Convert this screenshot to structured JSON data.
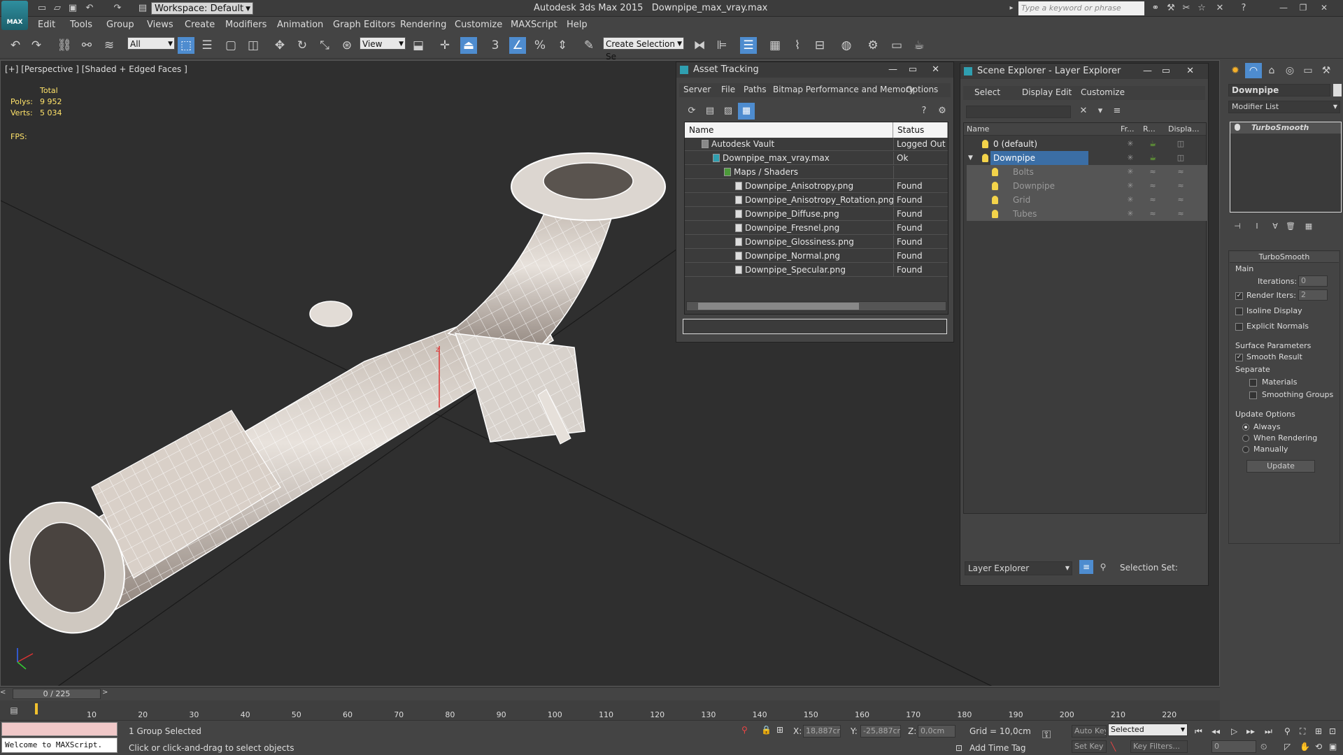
{
  "titlebar": {
    "workspace_label": "Workspace: Default",
    "app_title": "Autodesk 3ds Max 2015",
    "file_name": "Downpipe_max_vray.max",
    "search_placeholder": "Type a keyword or phrase",
    "logo_text": "MAX"
  },
  "menu": [
    "Edit",
    "Tools",
    "Group",
    "Views",
    "Create",
    "Modifiers",
    "Animation",
    "Graph Editors",
    "Rendering",
    "Customize",
    "MAXScript",
    "Help"
  ],
  "toolbar": {
    "selection_filter": "All",
    "ref_coord": "View",
    "named_selection_placeholder": "Create Selection Se",
    "snap_3": "3"
  },
  "viewport": {
    "label": "[+] [Perspective ] [Shaded + Edged Faces ]",
    "total_label": "Total",
    "polys_label": "Polys:",
    "polys_value": "9 952",
    "verts_label": "Verts:",
    "verts_value": "5 034",
    "fps_label": "FPS:",
    "gizmo_axis": "z"
  },
  "asset_tracking": {
    "title": "Asset Tracking",
    "menu": [
      "Server",
      "File",
      "Paths",
      "Bitmap Performance and Memory",
      "Options"
    ],
    "columns": [
      "Name",
      "Status"
    ],
    "rows": [
      {
        "name": "Autodesk Vault",
        "status": "Logged Out ..."
      },
      {
        "name": "Downpipe_max_vray.max",
        "status": "Ok"
      },
      {
        "name": "Maps / Shaders",
        "status": ""
      },
      {
        "name": "Downpipe_Anisotropy.png",
        "status": "Found"
      },
      {
        "name": "Downpipe_Anisotropy_Rotation.png",
        "status": "Found"
      },
      {
        "name": "Downpipe_Diffuse.png",
        "status": "Found"
      },
      {
        "name": "Downpipe_Fresnel.png",
        "status": "Found"
      },
      {
        "name": "Downpipe_Glossiness.png",
        "status": "Found"
      },
      {
        "name": "Downpipe_Normal.png",
        "status": "Found"
      },
      {
        "name": "Downpipe_Specular.png",
        "status": "Found"
      }
    ]
  },
  "scene_explorer": {
    "title": "Scene Explorer - Layer Explorer",
    "menu": [
      "Select",
      "Display",
      "Edit",
      "Customize"
    ],
    "columns": [
      "Name",
      "Fr...",
      "R...",
      "Displa..."
    ],
    "rows": [
      {
        "name": "0 (default)"
      },
      {
        "name": "Downpipe"
      },
      {
        "name": "Bolts"
      },
      {
        "name": "Downpipe"
      },
      {
        "name": "Grid"
      },
      {
        "name": "Tubes"
      }
    ],
    "footer_mode": "Layer Explorer",
    "selection_set_label": "Selection Set:"
  },
  "command_panel": {
    "object_name": "Downpipe",
    "modifier_list": "Modifier List",
    "stack_item": "TurboSmooth",
    "rollout_title": "TurboSmooth",
    "main_label": "Main",
    "iterations_label": "Iterations:",
    "iterations_value": "0",
    "render_iters_label": "Render Iters:",
    "render_iters_value": "2",
    "isoline_label": "Isoline Display",
    "explicit_normals_label": "Explicit Normals",
    "surface_params_label": "Surface Parameters",
    "smooth_result_label": "Smooth Result",
    "separate_label": "Separate",
    "materials_label": "Materials",
    "smoothing_groups_label": "Smoothing Groups",
    "update_options_label": "Update Options",
    "always_label": "Always",
    "when_rendering_label": "When Rendering",
    "manually_label": "Manually",
    "update_button": "Update",
    "render_iters_checked": true,
    "smooth_result_checked": true
  },
  "timeline": {
    "frame_label": "0 / 225",
    "ticks": [
      "10",
      "20",
      "30",
      "40",
      "50",
      "60",
      "70",
      "80",
      "90",
      "100",
      "110",
      "120",
      "130",
      "140",
      "150",
      "160",
      "170",
      "180",
      "190",
      "200",
      "210",
      "220"
    ]
  },
  "status": {
    "maxscript_text": "Welcome to MAXScript.",
    "selection_text": "1 Group Selected",
    "prompt_text": "Click or click-and-drag to select objects",
    "x_label": "X:",
    "x_value": "18,887cm",
    "y_label": "Y:",
    "y_value": "-25,887cm",
    "z_label": "Z:",
    "z_value": "0,0cm",
    "grid_text": "Grid = 10,0cm",
    "add_time_tag": "Add Time Tag",
    "auto_key": "Auto Key",
    "set_key": "Set Key",
    "selected_dd": "Selected",
    "key_filters": "Key Filters...",
    "frame_value": "0"
  }
}
